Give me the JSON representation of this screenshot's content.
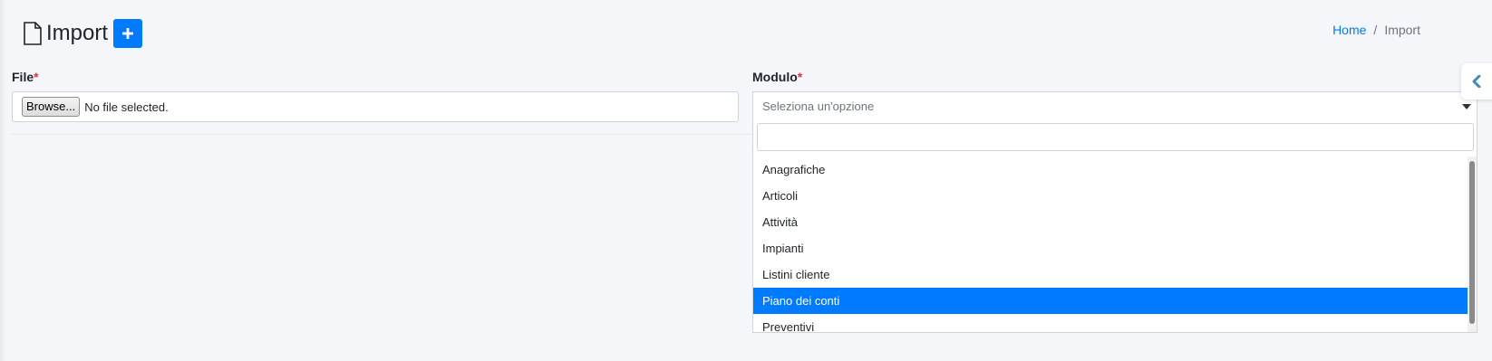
{
  "page": {
    "title": "Import",
    "icon": "file-icon"
  },
  "breadcrumb": {
    "home": "Home",
    "separator": "/",
    "current": "Import"
  },
  "form": {
    "file": {
      "label": "File",
      "required_mark": "*",
      "browse_label": "Browse...",
      "status": "No file selected."
    },
    "module": {
      "label": "Modulo",
      "required_mark": "*",
      "placeholder": "Seleziona un'opzione",
      "search_value": "",
      "options": [
        "Anagrafiche",
        "Articoli",
        "Attività",
        "Impianti",
        "Listini cliente",
        "Piano dei conti",
        "Preventivi"
      ],
      "highlighted_option": "Piano dei conti"
    }
  },
  "colors": {
    "accent": "#007bff",
    "required": "#dc3545",
    "background": "#f4f6f9"
  }
}
